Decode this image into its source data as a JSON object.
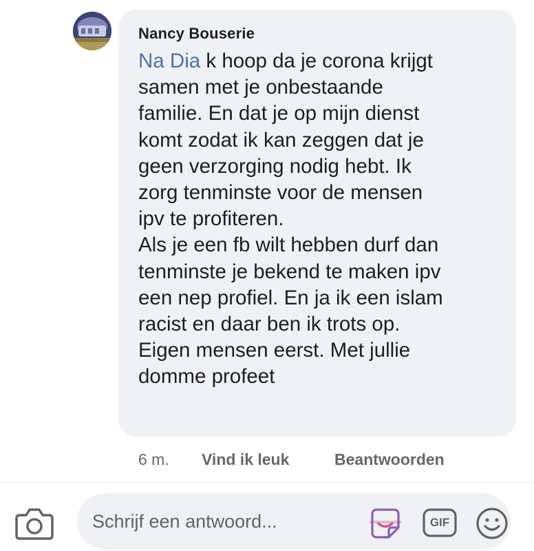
{
  "comment": {
    "author": "Nancy Bouserie",
    "mention": "Na Dia",
    "text": "  k hoop da je corona krijgt\nsamen met je onbestaande\nfamilie. En dat je op mijn dienst\nkomt zodat ik kan zeggen dat je\ngeen verzorging nodig hebt. Ik\nzorg tenminste voor de mensen\nipv te profiteren.\nAls je een fb wilt hebben durf dan\ntenminste je bekend te maken ipv\neen nep profiel. En ja ik een islam\nracist en daar ben ik trots op.\nEigen mensen eerst. Met jullie\ndomme profeet",
    "time": "6 m.",
    "like_label": "Vind ik leuk",
    "reply_label": "Beantwoorden"
  },
  "reply_bar": {
    "placeholder": "Schrijf een antwoord...",
    "gif_label": "GIF",
    "icons": [
      "camera-icon",
      "sticker-icon",
      "gif-icon",
      "emoji-icon"
    ]
  },
  "colors": {
    "bubble_bg": "#eff1f4",
    "mention": "#4d72b0",
    "text": "#1c1e21",
    "meta": "#65676b"
  }
}
